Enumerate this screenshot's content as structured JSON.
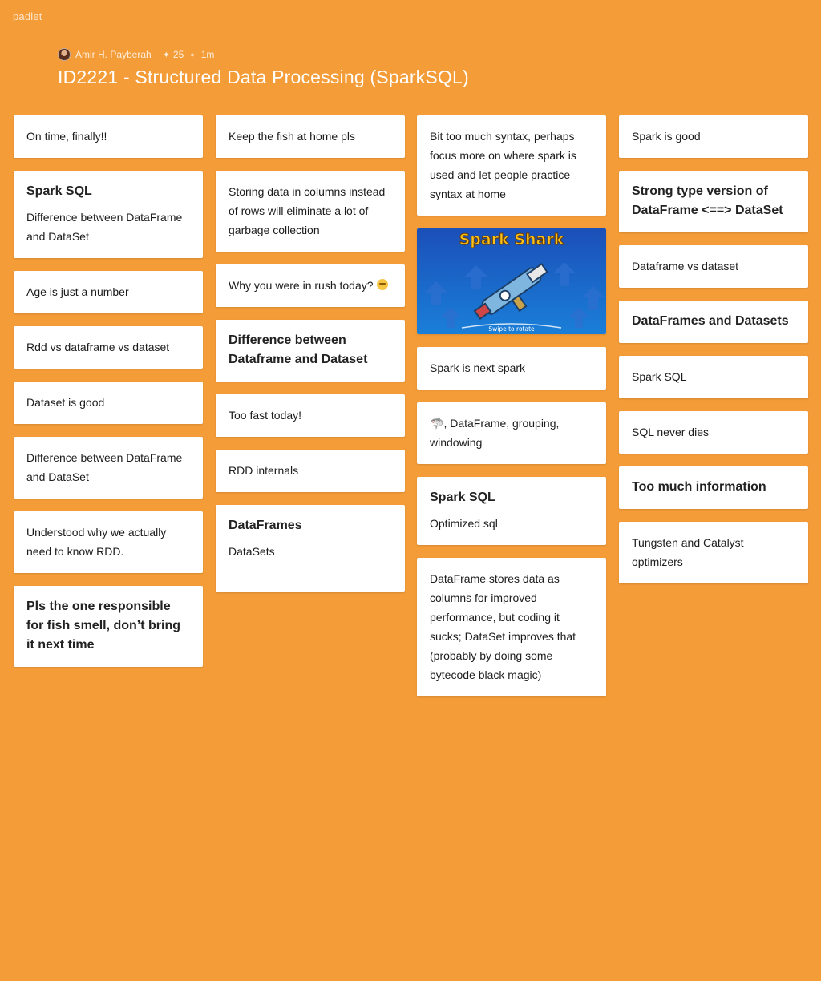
{
  "brand": "padlet",
  "header": {
    "author": "Amir H. Payberah",
    "star_icon": "✦",
    "likes": "25",
    "time": "1m",
    "title": "ID2221 - Structured Data Processing (SparkSQL)"
  },
  "colors": {
    "background": "#f39c38",
    "card": "#ffffff"
  },
  "columns": [
    {
      "cards": [
        {
          "head": "",
          "body": "On time, finally!!"
        },
        {
          "head": "Spark SQL",
          "body": "Difference between DataFrame and DataSet"
        },
        {
          "head": "",
          "body": "Age is just a number"
        },
        {
          "head": "",
          "body": "Rdd vs dataframe vs dataset"
        },
        {
          "head": "",
          "body": "Dataset is good"
        },
        {
          "head": "",
          "body": "Difference between DataFrame and DataSet"
        },
        {
          "head": "",
          "body": "Understood why we actually need to know RDD."
        },
        {
          "head": "Pls the one responsible for fish smell, don’t bring it next time",
          "body": ""
        }
      ]
    },
    {
      "cards": [
        {
          "head": "",
          "body": "Keep the fish at home pls"
        },
        {
          "head": "",
          "body": "Storing data in columns instead of rows will eliminate a lot of garbage collection"
        },
        {
          "head": "",
          "body": "Why you were in rush today?",
          "emoji": "thinking-face"
        },
        {
          "head": "Difference between Dataframe and Dataset",
          "body": ""
        },
        {
          "head": "",
          "body": "Too fast today!"
        },
        {
          "head": "",
          "body": "RDD internals"
        },
        {
          "head": "DataFrames",
          "body": "DataSets"
        }
      ]
    },
    {
      "cards": [
        {
          "head": "",
          "body": "Bit too much syntax, perhaps focus more on where spark is used and let people practice syntax at home"
        },
        {
          "image": true,
          "image_title": "Spark Shark",
          "image_caption": "Swipe to rotate"
        },
        {
          "head": "",
          "body": "Spark is next spark"
        },
        {
          "head": "",
          "body": ", DataFrame, grouping, windowing",
          "shark_emoji": "🦈"
        },
        {
          "head": "Spark SQL",
          "body": "Optimized sql"
        },
        {
          "head": "",
          "body": "DataFrame stores data as columns for improved performance, but coding it sucks; DataSet improves that (probably by doing some bytecode black magic)"
        }
      ]
    },
    {
      "cards": [
        {
          "head": "",
          "body": "Spark is good"
        },
        {
          "head": "Strong type version of DataFrame <==> DataSet",
          "body": ""
        },
        {
          "head": "",
          "body": "Dataframe vs dataset"
        },
        {
          "head": "DataFrames and Datasets",
          "body": ""
        },
        {
          "head": "",
          "body": "Spark SQL"
        },
        {
          "head": "",
          "body": "SQL never dies"
        },
        {
          "head": "Too much information",
          "body": ""
        },
        {
          "head": "",
          "body": "Tungsten and Catalyst optimizers"
        }
      ]
    }
  ]
}
